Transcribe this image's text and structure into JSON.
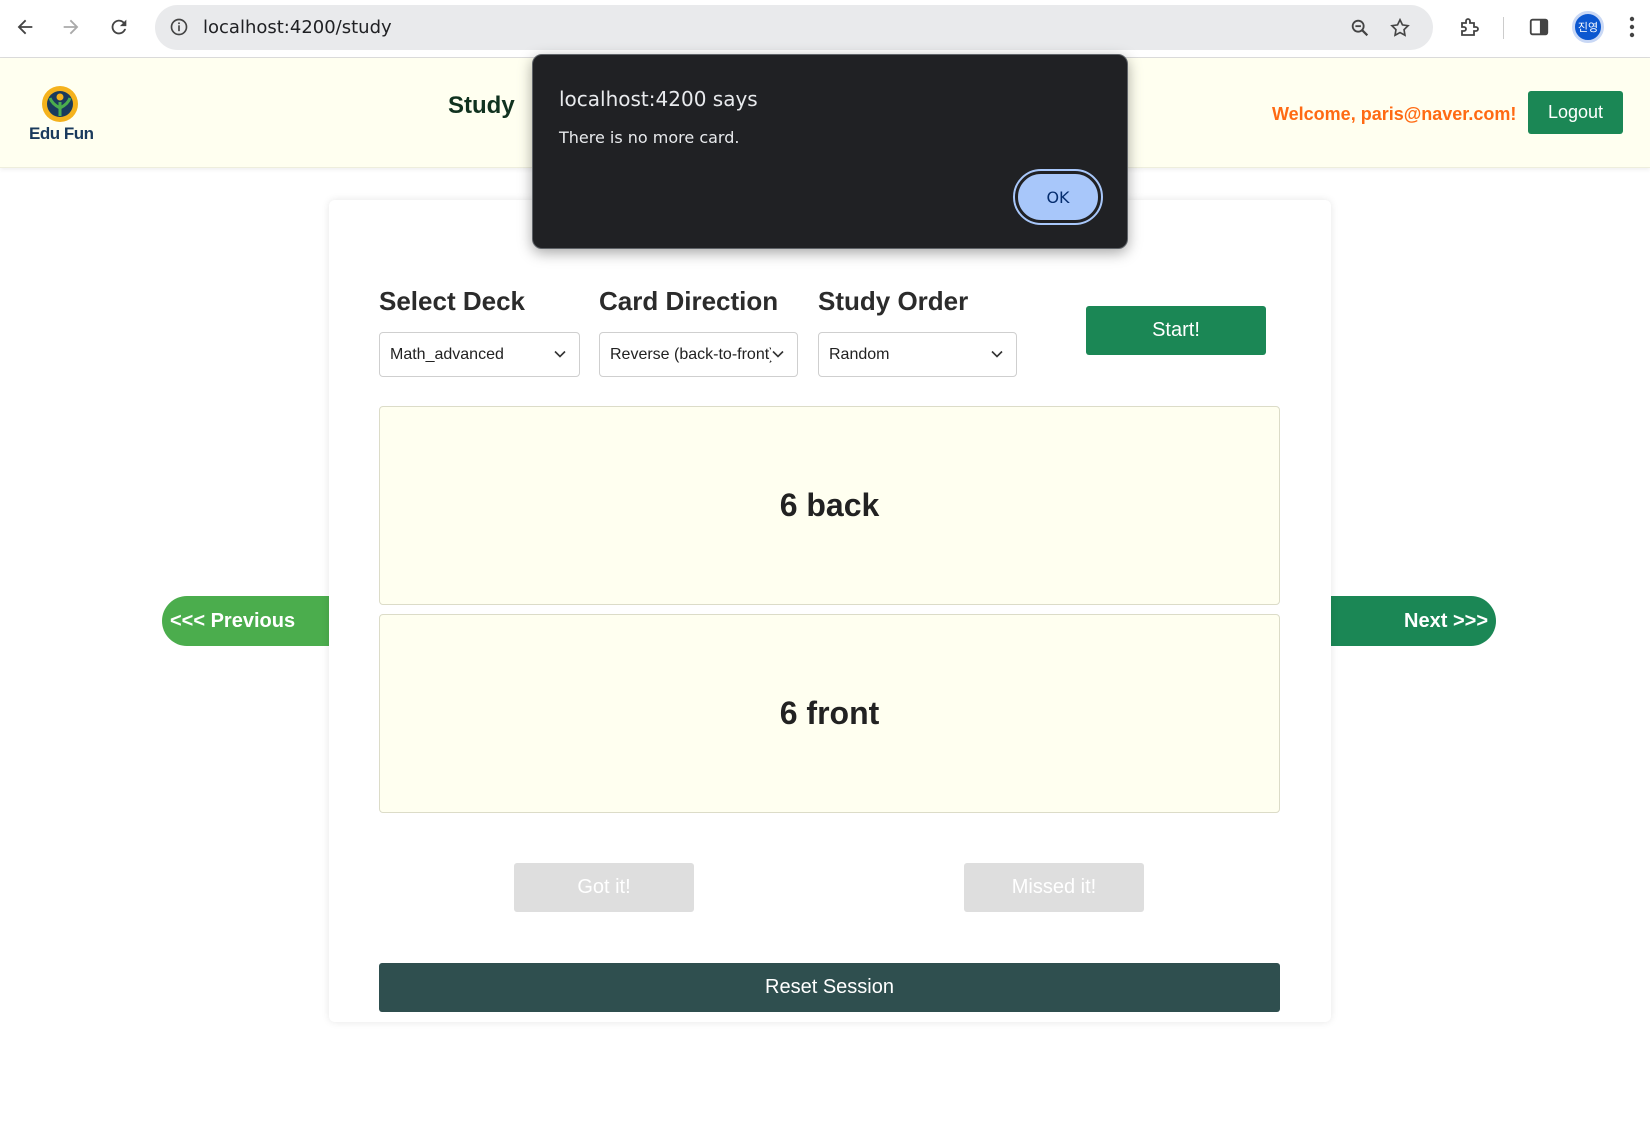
{
  "browser": {
    "url": "localhost:4200/study",
    "profile_initials": "진영"
  },
  "header": {
    "logo_text": "Edu Fun",
    "nav_study": "Study",
    "welcome": "Welcome, paris@naver.com!",
    "logout_label": "Logout"
  },
  "controls": {
    "deck_label": "Select Deck",
    "deck_value": "Math_advanced",
    "direction_label": "Card Direction",
    "direction_value": "Reverse (back-to-front)",
    "order_label": "Study Order",
    "order_value": "Random",
    "start_label": "Start!"
  },
  "cards": {
    "top_text": "6 back",
    "bottom_text": "6 front"
  },
  "actions": {
    "got_it": "Got it!",
    "missed_it": "Missed it!",
    "reset": "Reset Session",
    "previous": "<<< Previous",
    "next": "Next >>>"
  },
  "alert": {
    "title": "localhost:4200 says",
    "message": "There is no more card.",
    "ok_label": "OK"
  },
  "colors": {
    "primary_green": "#1b8755",
    "light_green": "#4bad4d",
    "header_bg": "#fffff0",
    "welcome_orange": "#ff6a13",
    "reset_dark": "#2f4f4f"
  }
}
